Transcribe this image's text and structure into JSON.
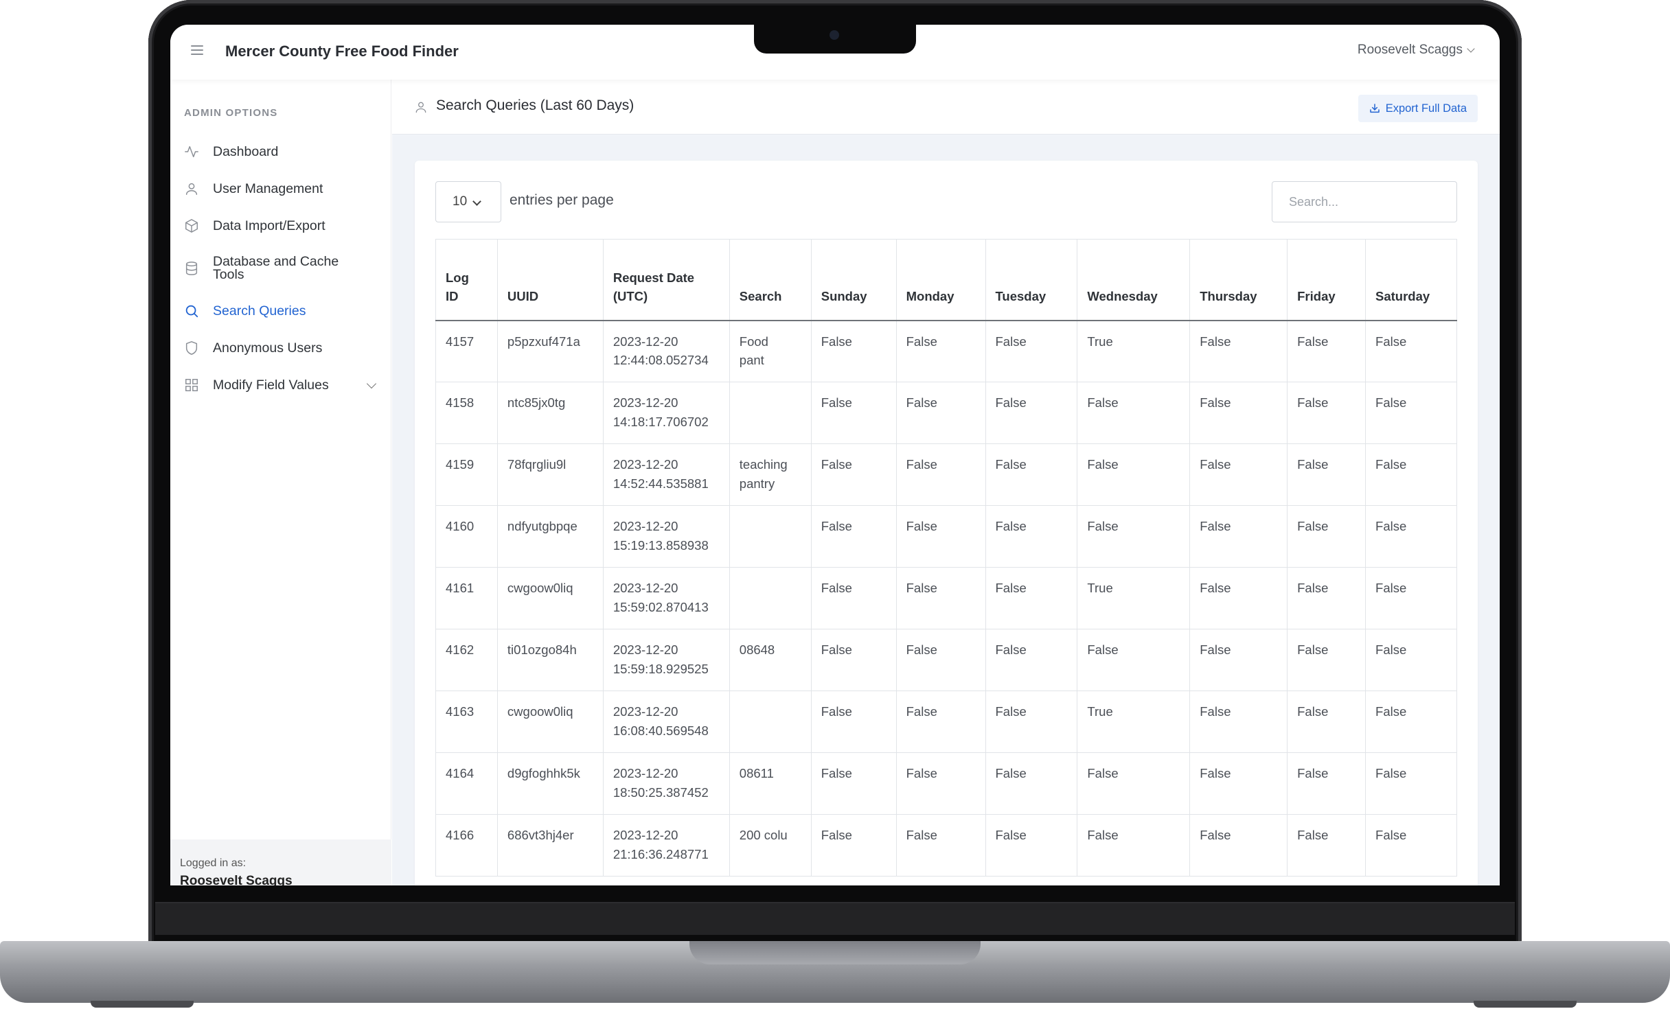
{
  "app": {
    "title": "Mercer County Free Food Finder",
    "user_menu": "Roosevelt Scaggs"
  },
  "sidebar": {
    "section_label": "ADMIN OPTIONS",
    "items": [
      {
        "label": "Dashboard",
        "icon": "activity-icon"
      },
      {
        "label": "User Management",
        "icon": "user-icon"
      },
      {
        "label": "Data Import/Export",
        "icon": "package-icon"
      },
      {
        "label": "Database and Cache Tools",
        "icon": "database-icon"
      },
      {
        "label": "Search Queries",
        "icon": "search-icon",
        "active": true
      },
      {
        "label": "Anonymous Users",
        "icon": "shield-icon"
      },
      {
        "label": "Modify Field Values",
        "icon": "grid-icon"
      }
    ],
    "logged_in_label": "Logged in as:",
    "logged_in_name": "Roosevelt Scaggs"
  },
  "page": {
    "title": "Search Queries (Last 60 Days)",
    "export_label": "Export Full Data"
  },
  "table_controls": {
    "page_size": "10",
    "per_page_label": "entries per page",
    "search_placeholder": "Search..."
  },
  "table": {
    "columns": [
      "Log ID",
      "UUID",
      "Request Date (UTC)",
      "Search",
      "Sunday",
      "Monday",
      "Tuesday",
      "Wednesday",
      "Thursday",
      "Friday",
      "Saturday"
    ],
    "rows": [
      [
        "4157",
        "p5pzxuf471a",
        "2023-12-20 12:44:08.052734",
        "Food pant",
        "False",
        "False",
        "False",
        "True",
        "False",
        "False",
        "False"
      ],
      [
        "4158",
        "ntc85jx0tg",
        "2023-12-20 14:18:17.706702",
        "",
        "False",
        "False",
        "False",
        "False",
        "False",
        "False",
        "False"
      ],
      [
        "4159",
        "78fqrgliu9l",
        "2023-12-20 14:52:44.535881",
        "teaching pantry",
        "False",
        "False",
        "False",
        "False",
        "False",
        "False",
        "False"
      ],
      [
        "4160",
        "ndfyutgbpqe",
        "2023-12-20 15:19:13.858938",
        "",
        "False",
        "False",
        "False",
        "False",
        "False",
        "False",
        "False"
      ],
      [
        "4161",
        "cwgoow0liq",
        "2023-12-20 15:59:02.870413",
        "",
        "False",
        "False",
        "False",
        "True",
        "False",
        "False",
        "False"
      ],
      [
        "4162",
        "ti01ozgo84h",
        "2023-12-20 15:59:18.929525",
        "08648",
        "False",
        "False",
        "False",
        "False",
        "False",
        "False",
        "False"
      ],
      [
        "4163",
        "cwgoow0liq",
        "2023-12-20 16:08:40.569548",
        "",
        "False",
        "False",
        "False",
        "True",
        "False",
        "False",
        "False"
      ],
      [
        "4164",
        "d9gfoghhk5k",
        "2023-12-20 18:50:25.387452",
        "08611",
        "False",
        "False",
        "False",
        "False",
        "False",
        "False",
        "False"
      ],
      [
        "4166",
        "686vt3hj4er",
        "2023-12-20 21:16:36.248771",
        "200 colu",
        "False",
        "False",
        "False",
        "False",
        "False",
        "False",
        "False"
      ]
    ]
  },
  "colors": {
    "accent": "#2264d1",
    "export_bg": "#eef3fb",
    "main_bg": "#f0f3f8"
  }
}
